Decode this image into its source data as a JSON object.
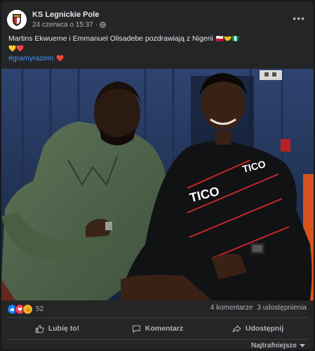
{
  "post": {
    "page_name": "KS Legnickie Pole",
    "timestamp": "24 czerwca o 15:37",
    "visibility_icon": "globe-icon",
    "more_icon": "more-options-icon",
    "text_line1": "Martins Ekwueme i Emmanuel Olisadebe pozdrawiają z Nigerii",
    "text_line1_flags": "🇵🇱🤝🇳🇬",
    "text_line2": "💛❤️",
    "hashtag": "#gramyrazem",
    "hashtag_heart": "❤️"
  },
  "photo": {
    "shirt_text_1": "TICO",
    "shirt_text_2": "TICO"
  },
  "stats": {
    "reaction_count": "52",
    "comments": "4 komentarze",
    "shares": "3 udostępnienia"
  },
  "actions": {
    "like": "Lubię to!",
    "comment": "Komentarz",
    "share": "Udostępnij"
  },
  "sort": {
    "label": "Najtrafniejsze"
  },
  "colors": {
    "card_bg": "#242526",
    "page_bg": "#18191a",
    "hashtag": "#4599ff",
    "like_blue": "#1877f2",
    "love_red": "#f33e58",
    "care_yellow": "#f7b125"
  }
}
